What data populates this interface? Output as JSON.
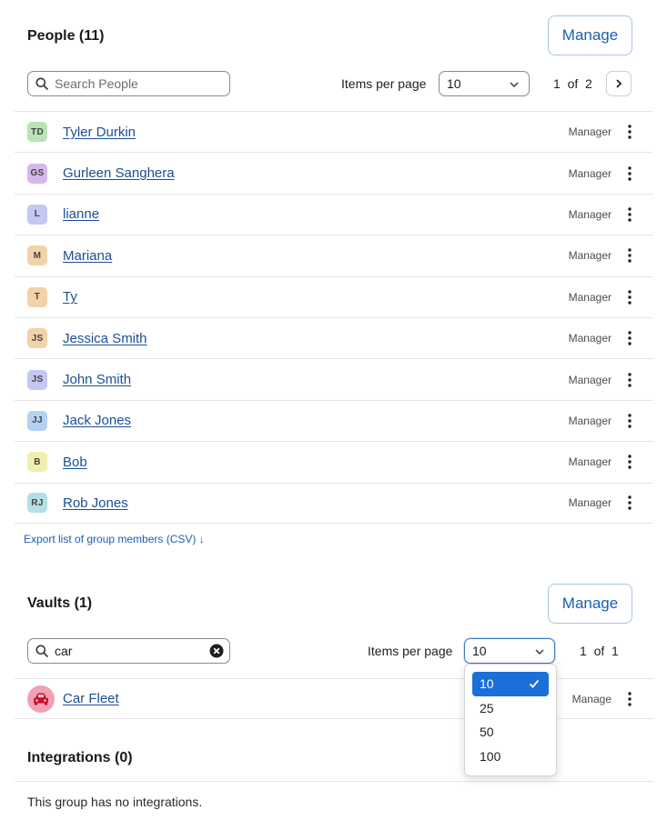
{
  "people": {
    "title": "People (11)",
    "manage_label": "Manage",
    "search_placeholder": "Search People",
    "items_per_page_label": "Items per page",
    "items_per_page_value": "10",
    "pager_text": "1  of  2",
    "rows": [
      {
        "initials": "TD",
        "name": "Tyler Durkin",
        "role": "Manager",
        "avatar_color": "#b9e3b5"
      },
      {
        "initials": "GS",
        "name": "Gurleen Sanghera",
        "role": "Manager",
        "avatar_color": "#d5b8ea"
      },
      {
        "initials": "L",
        "name": "lianne",
        "role": "Manager",
        "avatar_color": "#c3c7f2"
      },
      {
        "initials": "M",
        "name": "Mariana",
        "role": "Manager",
        "avatar_color": "#f2d2a8"
      },
      {
        "initials": "T",
        "name": "Ty",
        "role": "Manager",
        "avatar_color": "#f2d2a8"
      },
      {
        "initials": "JS",
        "name": "Jessica Smith",
        "role": "Manager",
        "avatar_color": "#f2d2a8"
      },
      {
        "initials": "JS",
        "name": "John Smith",
        "role": "Manager",
        "avatar_color": "#c3c7f2"
      },
      {
        "initials": "JJ",
        "name": "Jack Jones",
        "role": "Manager",
        "avatar_color": "#b3d2f2"
      },
      {
        "initials": "B",
        "name": "Bob",
        "role": "Manager",
        "avatar_color": "#f0efb0"
      },
      {
        "initials": "RJ",
        "name": "Rob Jones",
        "role": "Manager",
        "avatar_color": "#b3e0e6"
      }
    ],
    "export_label": "Export list of group members (CSV) ↓"
  },
  "vaults": {
    "title": "Vaults (1)",
    "manage_label": "Manage",
    "search_value": "car",
    "items_per_page_label": "Items per page",
    "items_per_page_value": "10",
    "pager_text": "1  of  1",
    "rows": [
      {
        "name": "Car Fleet",
        "role": "Manage",
        "icon": "car-icon"
      }
    ],
    "dropdown_options": [
      {
        "label": "10",
        "selected": true
      },
      {
        "label": "25",
        "selected": false
      },
      {
        "label": "50",
        "selected": false
      },
      {
        "label": "100",
        "selected": false
      }
    ]
  },
  "integrations": {
    "title": "Integrations (0)",
    "empty_text": "This group has no integrations."
  }
}
